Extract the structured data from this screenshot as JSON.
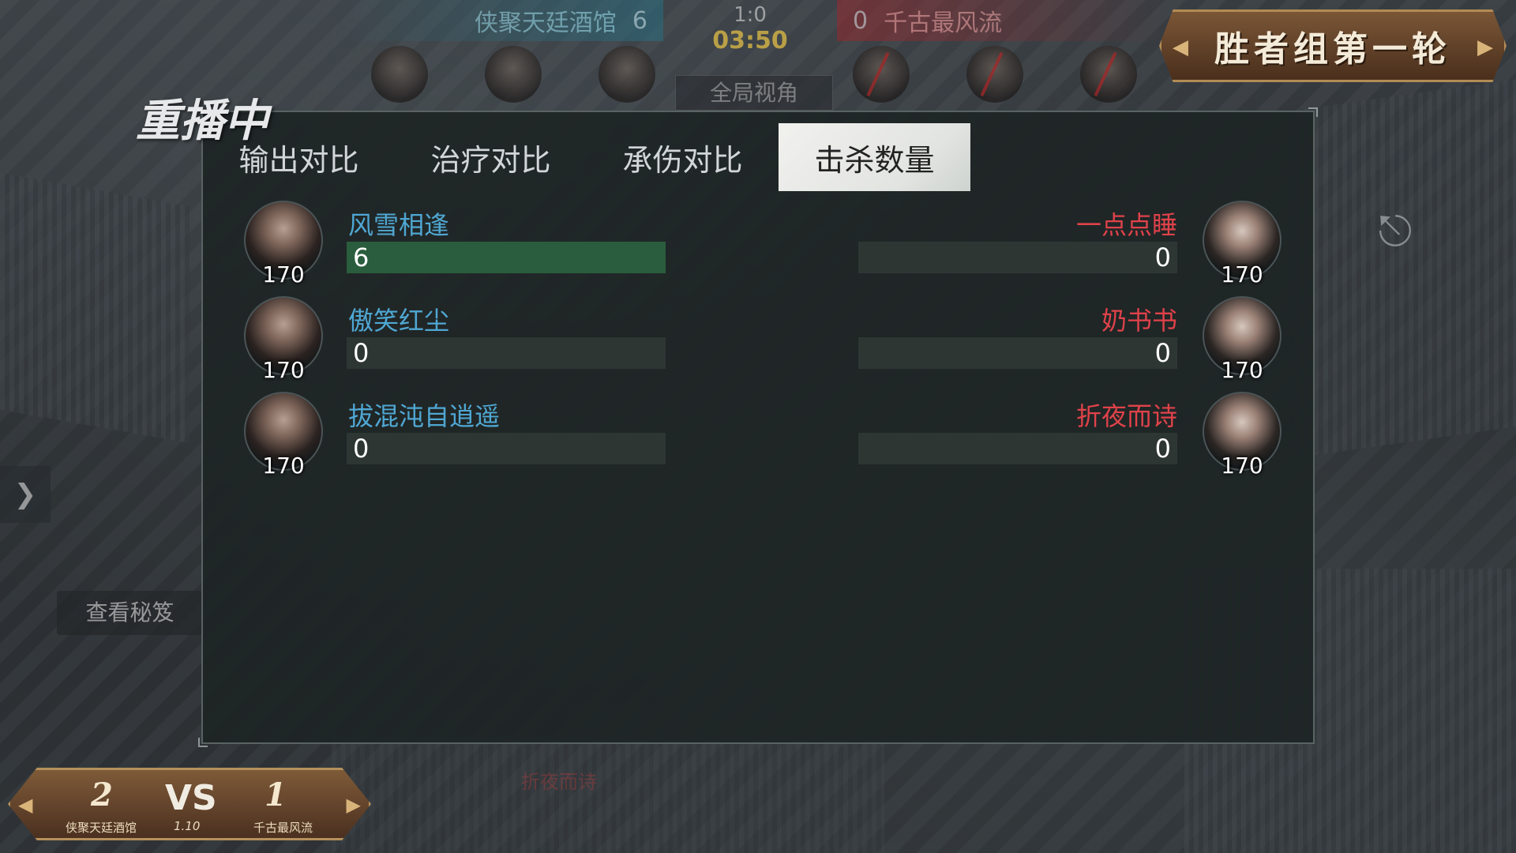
{
  "hud": {
    "left_team": "侠聚天廷酒馆",
    "left_kills": "6",
    "series_score": "1:0",
    "timer": "03:50",
    "right_kills": "0",
    "right_team": "千古最风流",
    "global_view_label": "全局视角"
  },
  "round_banner": "胜者组第一轮",
  "replay_label": "重播中",
  "secret_button": "查看秘笈",
  "tabs": [
    {
      "label": "输出对比",
      "active": false
    },
    {
      "label": "治疗对比",
      "active": false
    },
    {
      "label": "承伤对比",
      "active": false
    },
    {
      "label": "击杀数量",
      "active": true
    }
  ],
  "stat_max": 6,
  "rows": [
    {
      "left": {
        "name": "风雪相逢",
        "level": "170",
        "value": "6"
      },
      "right": {
        "name": "一点点睡",
        "level": "170",
        "value": "0"
      }
    },
    {
      "left": {
        "name": "傲笑红尘",
        "level": "170",
        "value": "0"
      },
      "right": {
        "name": "奶书书",
        "level": "170",
        "value": "0"
      }
    },
    {
      "left": {
        "name": "拔混沌自逍遥",
        "level": "170",
        "value": "0"
      },
      "right": {
        "name": "折夜而诗",
        "level": "170",
        "value": "0"
      }
    }
  ],
  "score_badge": {
    "left_score": "2",
    "vs": "VS",
    "right_score": "1",
    "date": "1.10",
    "left_team": "侠聚天廷酒馆",
    "right_team": "千古最风流"
  },
  "colors": {
    "left_team": "#4fa7d3",
    "right_team": "#e0424a",
    "bar_fill": "#2a5d3d",
    "active_tab": "#f1f1ee"
  },
  "icons": {
    "exit": "exit-door-icon",
    "side_toggle": "chevron-right-icon"
  }
}
